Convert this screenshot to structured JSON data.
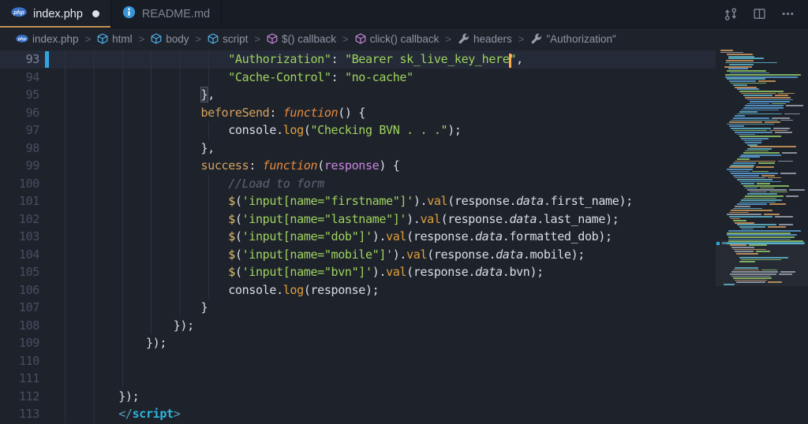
{
  "tabbar": {
    "tabs": [
      {
        "name": "index.php",
        "icon": "php",
        "modified": true,
        "active": true
      },
      {
        "name": "README.md",
        "icon": "info",
        "modified": false,
        "active": false
      }
    ],
    "actions": [
      {
        "name": "open-changes"
      },
      {
        "name": "split-editor"
      },
      {
        "name": "more-actions"
      }
    ]
  },
  "icons": {
    "php_label": "php"
  },
  "breadcrumbs": {
    "separator": ">",
    "items": [
      {
        "label": "index.php",
        "icon": "php"
      },
      {
        "label": "html",
        "icon": "cube-blue"
      },
      {
        "label": "body",
        "icon": "cube-blue"
      },
      {
        "label": "script",
        "icon": "cube-blue"
      },
      {
        "label": "$() callback",
        "icon": "cube-purple"
      },
      {
        "label": "click() callback",
        "icon": "cube-purple"
      },
      {
        "label": "headers",
        "icon": "wrench"
      },
      {
        "label": "\"Authorization\"",
        "icon": "wrench"
      }
    ]
  },
  "colors": {
    "editor_bg": "#1e222b",
    "tabbar_bg": "#181c24",
    "accent_underline": "#c89253",
    "string": "#9ed35e",
    "property": "#d6a35e",
    "keyword": "#e98a3c",
    "method": "#e0a03a",
    "param": "#c887e0",
    "comment": "#5d6675",
    "tag": "#2cb5dd",
    "cursor": "#ffac4d",
    "modified_marker": "#2da8de",
    "guide": "#2b3242",
    "line_number": "#454f63"
  },
  "editor": {
    "lines": [
      {
        "num": 93,
        "indent": 28,
        "current": true,
        "modified": true,
        "tokens": [
          [
            "str",
            "\"Authorization\""
          ],
          [
            "pun",
            ": "
          ],
          [
            "str",
            "\"Bearer sk_live_key_here"
          ],
          [
            "cursor",
            ""
          ],
          [
            "str",
            "\""
          ],
          [
            "pun",
            ","
          ]
        ]
      },
      {
        "num": 94,
        "indent": 28,
        "tokens": [
          [
            "str",
            "\"Cache-Control\""
          ],
          [
            "pun",
            ": "
          ],
          [
            "str",
            "\"no-cache\""
          ]
        ]
      },
      {
        "num": 95,
        "indent": 24,
        "tokens": [
          [
            "brkt",
            "}"
          ],
          [
            "pun",
            ","
          ]
        ]
      },
      {
        "num": 96,
        "indent": 24,
        "tokens": [
          [
            "prop",
            "beforeSend"
          ],
          [
            "pun",
            ": "
          ],
          [
            "kw",
            "function"
          ],
          [
            "pun",
            "() {"
          ]
        ]
      },
      {
        "num": 97,
        "indent": 28,
        "tokens": [
          [
            "var",
            "console"
          ],
          [
            "pun",
            "."
          ],
          [
            "fn",
            "log"
          ],
          [
            "pun",
            "("
          ],
          [
            "str",
            "\"Checking BVN . . .\""
          ],
          [
            "pun",
            ");"
          ]
        ]
      },
      {
        "num": 98,
        "indent": 24,
        "tokens": [
          [
            "pun",
            "},"
          ]
        ]
      },
      {
        "num": 99,
        "indent": 24,
        "tokens": [
          [
            "prop",
            "success"
          ],
          [
            "pun",
            ": "
          ],
          [
            "kw",
            "function"
          ],
          [
            "pun",
            "("
          ],
          [
            "param",
            "response"
          ],
          [
            "pun",
            ") {"
          ]
        ]
      },
      {
        "num": 100,
        "indent": 28,
        "tokens": [
          [
            "com",
            "//Load to form"
          ]
        ]
      },
      {
        "num": 101,
        "indent": 28,
        "tokens": [
          [
            "dollar",
            "$"
          ],
          [
            "pun",
            "("
          ],
          [
            "str",
            "'input[name=\"firstname\"]'"
          ],
          [
            "pun",
            ")."
          ],
          [
            "fn",
            "val"
          ],
          [
            "pun",
            "("
          ],
          [
            "var",
            "response"
          ],
          [
            "pun",
            "."
          ],
          [
            "data",
            "data"
          ],
          [
            "pun",
            "."
          ],
          [
            "var",
            "first_name"
          ],
          [
            "pun",
            ");"
          ]
        ]
      },
      {
        "num": 102,
        "indent": 28,
        "tokens": [
          [
            "dollar",
            "$"
          ],
          [
            "pun",
            "("
          ],
          [
            "str",
            "'input[name=\"lastname\"]'"
          ],
          [
            "pun",
            ")."
          ],
          [
            "fn",
            "val"
          ],
          [
            "pun",
            "("
          ],
          [
            "var",
            "response"
          ],
          [
            "pun",
            "."
          ],
          [
            "data",
            "data"
          ],
          [
            "pun",
            "."
          ],
          [
            "var",
            "last_name"
          ],
          [
            "pun",
            ");"
          ]
        ]
      },
      {
        "num": 103,
        "indent": 28,
        "tokens": [
          [
            "dollar",
            "$"
          ],
          [
            "pun",
            "("
          ],
          [
            "str",
            "'input[name=\"dob\"]'"
          ],
          [
            "pun",
            ")."
          ],
          [
            "fn",
            "val"
          ],
          [
            "pun",
            "("
          ],
          [
            "var",
            "response"
          ],
          [
            "pun",
            "."
          ],
          [
            "data",
            "data"
          ],
          [
            "pun",
            "."
          ],
          [
            "var",
            "formatted_dob"
          ],
          [
            "pun",
            ");"
          ]
        ]
      },
      {
        "num": 104,
        "indent": 28,
        "tokens": [
          [
            "dollar",
            "$"
          ],
          [
            "pun",
            "("
          ],
          [
            "str",
            "'input[name=\"mobile\"]'"
          ],
          [
            "pun",
            ")."
          ],
          [
            "fn",
            "val"
          ],
          [
            "pun",
            "("
          ],
          [
            "var",
            "response"
          ],
          [
            "pun",
            "."
          ],
          [
            "data",
            "data"
          ],
          [
            "pun",
            "."
          ],
          [
            "var",
            "mobile"
          ],
          [
            "pun",
            ");"
          ]
        ]
      },
      {
        "num": 105,
        "indent": 28,
        "tokens": [
          [
            "dollar",
            "$"
          ],
          [
            "pun",
            "("
          ],
          [
            "str",
            "'input[name=\"bvn\"]'"
          ],
          [
            "pun",
            ")."
          ],
          [
            "fn",
            "val"
          ],
          [
            "pun",
            "("
          ],
          [
            "var",
            "response"
          ],
          [
            "pun",
            "."
          ],
          [
            "data",
            "data"
          ],
          [
            "pun",
            "."
          ],
          [
            "var",
            "bvn"
          ],
          [
            "pun",
            ");"
          ]
        ]
      },
      {
        "num": 106,
        "indent": 28,
        "tokens": [
          [
            "var",
            "console"
          ],
          [
            "pun",
            "."
          ],
          [
            "fn",
            "log"
          ],
          [
            "pun",
            "("
          ],
          [
            "var",
            "response"
          ],
          [
            "pun",
            ");"
          ]
        ]
      },
      {
        "num": 107,
        "indent": 24,
        "tokens": [
          [
            "pun",
            "}"
          ]
        ]
      },
      {
        "num": 108,
        "indent": 20,
        "tokens": [
          [
            "pun",
            "});"
          ]
        ]
      },
      {
        "num": 109,
        "indent": 16,
        "tokens": [
          [
            "pun",
            "});"
          ]
        ]
      },
      {
        "num": 110,
        "indent": 0,
        "guides": 3,
        "tokens": []
      },
      {
        "num": 111,
        "indent": 0,
        "guides": 3,
        "tokens": []
      },
      {
        "num": 112,
        "indent": 12,
        "tokens": [
          [
            "pun",
            "});"
          ]
        ]
      },
      {
        "num": 113,
        "indent": 12,
        "tokens": [
          [
            "tagp",
            "</"
          ],
          [
            "tag",
            "script"
          ],
          [
            "pun_tail",
            ""
          ],
          [
            "tagp",
            ">"
          ]
        ]
      }
    ]
  },
  "minimap": {
    "rows_total": 115,
    "highlight_row": 94,
    "pitch": 2.605,
    "bar_height": 1.7,
    "left_margin": 6,
    "palette": {
      "cyan": "#5fb4c9",
      "blue": "#5a9fd4",
      "orange": "#cf9a5e",
      "green": "#8fc768",
      "white": "#9aa3b0",
      "purple": "#b678d6"
    },
    "band_color": "rgba(86,186,214,0.6)"
  }
}
